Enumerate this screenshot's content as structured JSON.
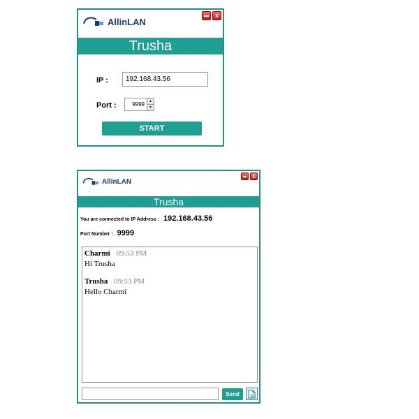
{
  "login_window": {
    "logo_text": "AllinLAN",
    "title": "Trusha",
    "ip_label": "IP  :",
    "ip_value": "192.168.43.56",
    "port_label": "Port  :",
    "port_value": "9999",
    "start_label": "START",
    "close_symbol": "x"
  },
  "chat_window": {
    "logo_text": "AllinLAN",
    "title": "Trusha",
    "connected_label": "You are connected to IP Address :",
    "connected_ip": "192.168.43.56",
    "port_label": "Port Number :",
    "port_value": "9999",
    "messages": [
      {
        "sender": "Charmi",
        "time": "09:53 PM",
        "text": "Hi Trusha"
      },
      {
        "sender": "Trusha",
        "time": "09:53 PM",
        "text": "Hello Charmi"
      }
    ],
    "send_label": "Send",
    "close_symbol": "x"
  },
  "colors": {
    "accent": "#1f9e92",
    "border": "#2e8b83",
    "logo": "#1c3d72",
    "window_button": "#c41a1a"
  },
  "icons": {
    "logo": "network-cable-icon",
    "minimize": "minimize-icon",
    "close": "close-icon",
    "attach": "attach-file-icon",
    "spin_up": "spin-up-icon",
    "spin_down": "spin-down-icon"
  }
}
